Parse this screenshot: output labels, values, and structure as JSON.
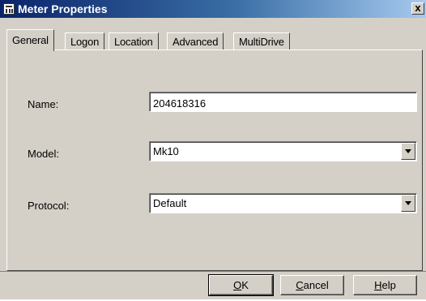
{
  "window": {
    "title": "Meter Properties",
    "close_label": "x"
  },
  "tabs": [
    {
      "label": "General",
      "active": true
    },
    {
      "label": "Logon",
      "active": false
    },
    {
      "label": "Location",
      "active": false
    },
    {
      "label": "Advanced",
      "active": false
    },
    {
      "label": "MultiDrive",
      "active": false
    }
  ],
  "form": {
    "name_label": "Name:",
    "name_value": "204618316",
    "model_label": "Model:",
    "model_value": "Mk10",
    "protocol_label": "Protocol:",
    "protocol_value": "Default"
  },
  "buttons": {
    "ok": {
      "mnemonic": "O",
      "rest": "K"
    },
    "cancel": {
      "mnemonic": "C",
      "rest": "ancel"
    },
    "help": {
      "mnemonic": "H",
      "rest": "elp"
    }
  },
  "colors": {
    "titlebar_start": "#0a246a",
    "titlebar_end": "#a6caf0",
    "face": "#d4d0c8"
  },
  "icons": {
    "window": "meter-icon",
    "close": "close-icon",
    "dropdown": "chevron-down-icon"
  }
}
